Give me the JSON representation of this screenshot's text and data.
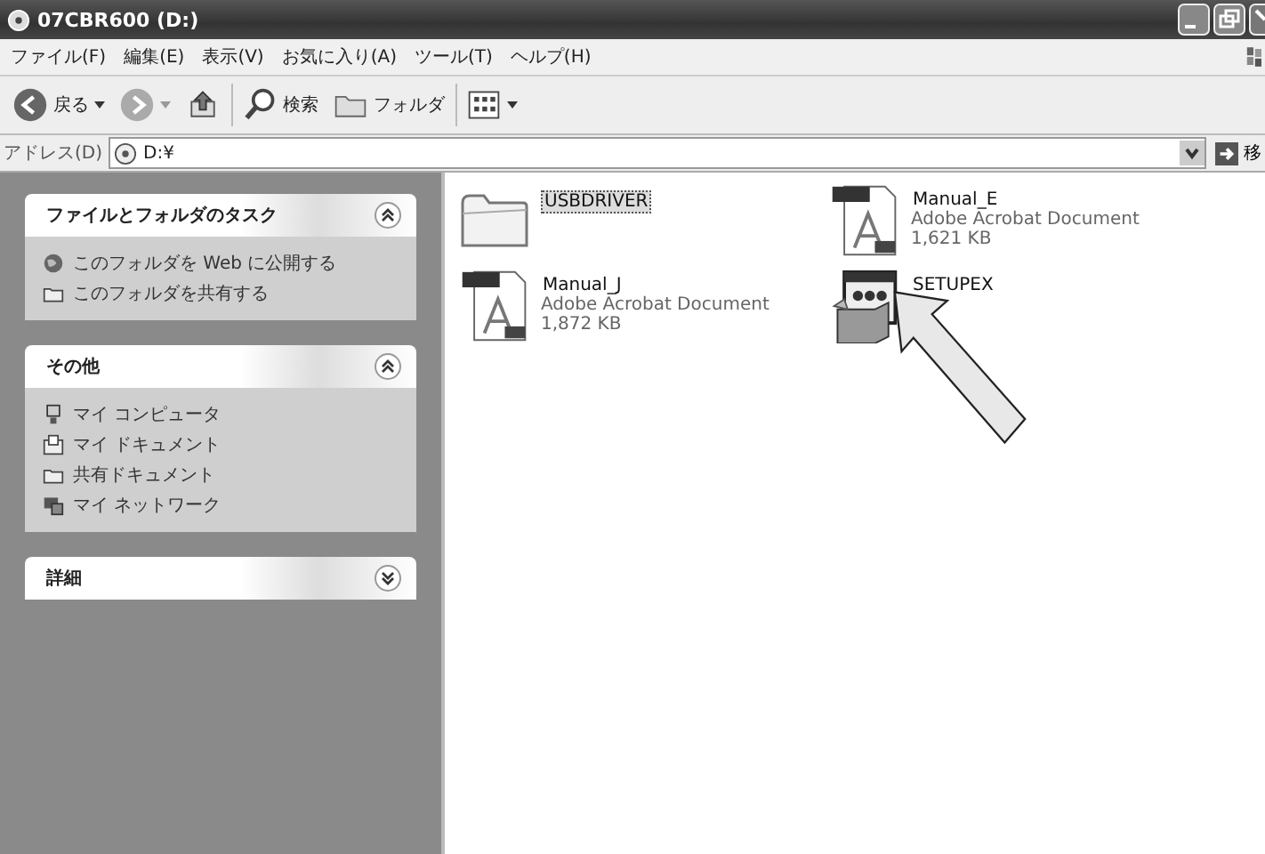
{
  "window": {
    "title": "07CBR600 (D:)"
  },
  "menu": [
    "ファイル(F)",
    "編集(E)",
    "表示(V)",
    "お気に入り(A)",
    "ツール(T)",
    "ヘルプ(H)"
  ],
  "toolbar": [
    {
      "kind": "back",
      "label": "戻る"
    },
    {
      "kind": "forward"
    },
    {
      "kind": "up"
    },
    {
      "kind": "search",
      "label": "検索"
    },
    {
      "kind": "folders",
      "label": "フォルダ"
    },
    {
      "kind": "views"
    }
  ],
  "address": {
    "label": "アドレス(D)",
    "value": "D:¥",
    "go": "移"
  },
  "panels": [
    {
      "title": "ファイルとフォルダのタスク",
      "expanded": true,
      "items": [
        {
          "kind": "globe",
          "label": "このフォルダを Web に公開する"
        },
        {
          "kind": "share",
          "label": "このフォルダを共有する"
        }
      ]
    },
    {
      "title": "その他",
      "expanded": true,
      "items": [
        {
          "kind": "computer",
          "label": "マイ コンピュータ"
        },
        {
          "kind": "documents",
          "label": "マイ ドキュメント"
        },
        {
          "kind": "folder",
          "label": "共有ドキュメント"
        },
        {
          "kind": "network",
          "label": "マイ ネットワーク"
        }
      ]
    },
    {
      "title": "詳細",
      "expanded": false
    }
  ],
  "files": [
    {
      "kind": "folder",
      "name": "USBDRIVER",
      "selected": true
    },
    {
      "kind": "pdf",
      "name": "Manual_E",
      "type": "Adobe Acrobat Document",
      "size": "1,621 KB",
      "selected": false
    },
    {
      "kind": "pdf",
      "name": "Manual_J",
      "type": "Adobe Acrobat Document",
      "size": "1,872 KB",
      "selected": false
    },
    {
      "kind": "exe",
      "name": "SETUPEX",
      "selected": false
    }
  ]
}
